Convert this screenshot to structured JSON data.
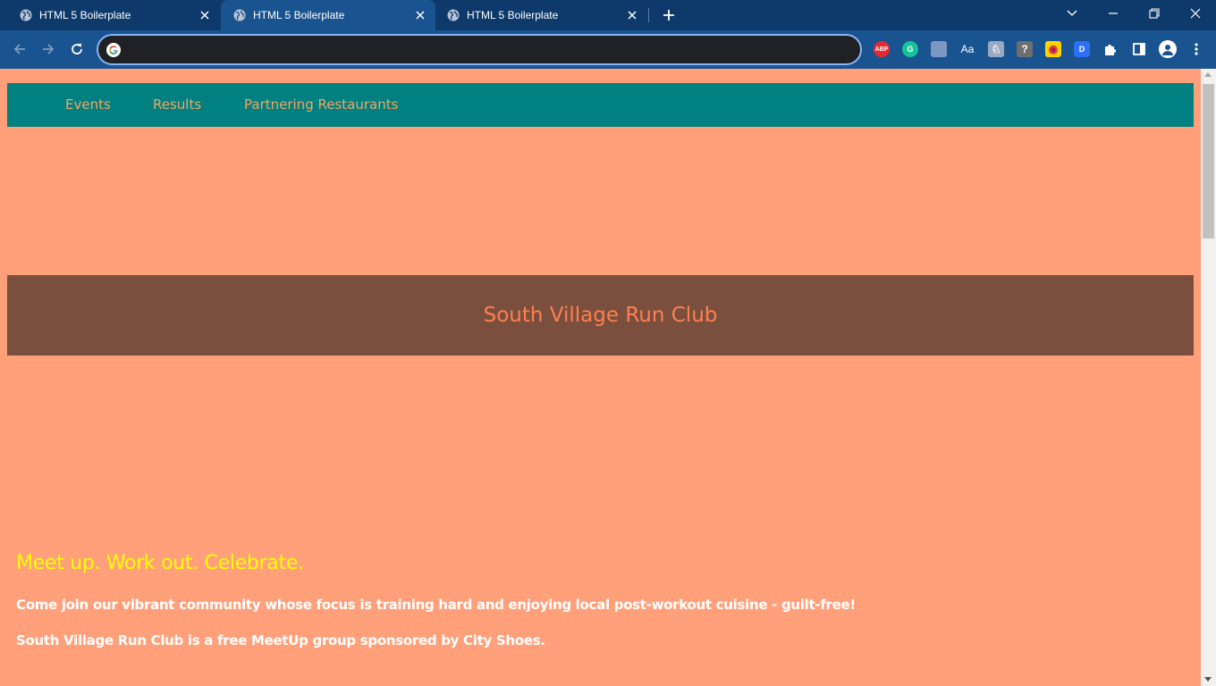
{
  "browser": {
    "tabs": [
      {
        "title": "HTML 5 Boilerplate",
        "active": false
      },
      {
        "title": "HTML 5 Boilerplate",
        "active": true
      },
      {
        "title": "HTML 5 Boilerplate",
        "active": false
      }
    ],
    "address_value": "",
    "extensions": [
      {
        "name": "adblock-plus-icon",
        "label": "ABP",
        "color": "#e62a30"
      },
      {
        "name": "grammarly-icon",
        "label": "G",
        "color": "#15c39a"
      },
      {
        "name": "extension-square-icon",
        "label": "",
        "color": "#7d96c4"
      },
      {
        "name": "dictionary-icon",
        "label": "Aa",
        "color": "#1a5490"
      },
      {
        "name": "translate-icon",
        "label": "♘",
        "color": "#9aa9c2"
      },
      {
        "name": "help-icon",
        "label": "?",
        "color": "#6e6e6e"
      },
      {
        "name": "honey-icon",
        "label": "◉",
        "color": "#ffd200"
      },
      {
        "name": "dashlane-icon",
        "label": "D",
        "color": "#2d6ff7"
      }
    ]
  },
  "page": {
    "nav": [
      "Events",
      "Results",
      "Partnering Restaurants"
    ],
    "hero_title": "South Village Run Club",
    "tagline": "Meet up. Work out. Celebrate.",
    "paragraphs": [
      "Come join our vibrant community whose focus is training hard and enjoying local post-workout cuisine - guilt-free!",
      "South Village Run Club is a free MeetUp group sponsored by City Shoes."
    ]
  },
  "colors": {
    "page_background": "#ffa07a",
    "nav_background": "#008080",
    "nav_link": "#f4a460",
    "hero_background": "#7a4f3d",
    "hero_text": "#ff7f50",
    "tagline": "#ffff00",
    "paragraph": "#ffffff"
  }
}
